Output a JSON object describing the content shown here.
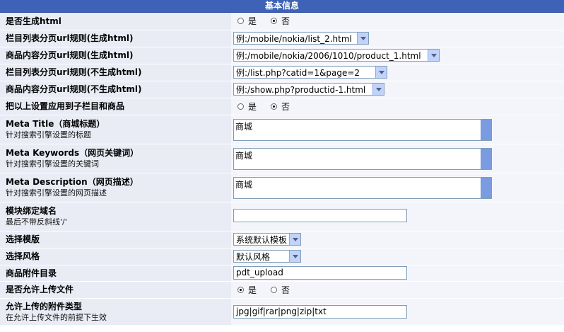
{
  "header": {
    "title": "基本信息"
  },
  "rows": {
    "gen_html": {
      "label": "是否生成html",
      "opt_yes": "是",
      "opt_no": "否",
      "selected": "否"
    },
    "list_url_html": {
      "label": "栏目列表分页url规则(生成html)",
      "value": "例:/mobile/nokia/list_2.html"
    },
    "product_url_html": {
      "label": "商品内容分页url规则(生成html)",
      "value": "例:/mobile/nokia/2006/1010/product_1.html"
    },
    "list_url_nohtml": {
      "label": "栏目列表分页url规则(不生成html)",
      "value": "例:/list.php?catid=1&page=2"
    },
    "product_url_nohtml": {
      "label": "商品内容分页url规则(不生成html)",
      "value": "例:/show.php?productid-1.html"
    },
    "apply_children": {
      "label": "把以上设置应用到子栏目和商品",
      "opt_yes": "是",
      "opt_no": "否",
      "selected": "否"
    },
    "meta_title": {
      "label": "Meta Title（商城标题）",
      "sub": "针对搜索引擎设置的标题",
      "value": "商城"
    },
    "meta_keywords": {
      "label": "Meta Keywords（网页关键词）",
      "sub": "针对搜索引擎设置的关键词",
      "value": "商城"
    },
    "meta_description": {
      "label": "Meta Description（网页描述）",
      "sub": "针对搜索引擎设置的网页描述",
      "value": "商城"
    },
    "module_domain": {
      "label": "模块绑定域名",
      "sub": "最后不带反斜线'/'",
      "value": ""
    },
    "template": {
      "label": "选择模版",
      "value": "系统默认模板"
    },
    "style": {
      "label": "选择风格",
      "value": "默认风格"
    },
    "attach_dir": {
      "label": "商品附件目录",
      "value": "pdt_upload"
    },
    "allow_upload": {
      "label": "是否允许上传文件",
      "opt_yes": "是",
      "opt_no": "否",
      "selected": "是"
    },
    "allowed_types": {
      "label": "允许上传的附件类型",
      "sub": "在允许上传文件的前提下生效",
      "value": "jpg|gif|rar|png|zip|txt"
    }
  },
  "colors": {
    "header_bg": "#3d62b8",
    "label_bg": "#e9ecf5",
    "value_bg": "#f4f5fa",
    "scrollbar": "#7a9be0"
  }
}
